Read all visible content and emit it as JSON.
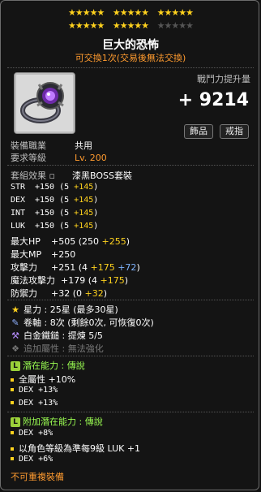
{
  "stars": {
    "row1_filled": 15,
    "row2_filled": 10,
    "row2_empty": 5
  },
  "item": {
    "name": "巨大的恐怖",
    "trade_note": "可交換1次(交易後無法交換)",
    "power_label": "戰鬥力提升量",
    "power_value": "+ 9214",
    "buttons": {
      "accessory": "飾品",
      "ring": "戒指"
    },
    "job_label": "裝備職業",
    "job_value": "共用",
    "level_label": "要求等級",
    "level_value": "Lv. 200",
    "set_label": "套組效果",
    "set_value": "漆黑BOSS套裝",
    "stats": [
      {
        "name": "STR",
        "text": "+150 (5 ",
        "bonus": "+145",
        "close": ")"
      },
      {
        "name": "DEX",
        "text": "+150 (5 ",
        "bonus": "+145",
        "close": ")"
      },
      {
        "name": "INT",
        "text": "+150 (5 ",
        "bonus": "+145",
        "close": ")"
      },
      {
        "name": "LUK",
        "text": "+150 (5 ",
        "bonus": "+145",
        "close": ")"
      }
    ],
    "maxhp": {
      "name": "最大HP",
      "text": "+505 (250 ",
      "bonus": "+255",
      "close": ")"
    },
    "maxmp": {
      "name": "最大MP",
      "text": "+250"
    },
    "atk": {
      "name": "攻擊力",
      "text": "+251 (4 ",
      "bonus": "+175",
      "bonus2": "+72",
      "close": ")"
    },
    "matk": {
      "name": "魔法攻擊力",
      "text": "+179 (4 ",
      "bonus": "+175",
      "close": ")"
    },
    "def": {
      "name": "防禦力",
      "text": "+32 (0 ",
      "bonus": "+32",
      "close": ")"
    },
    "starforce": "星力 : 25星 (最多30星)",
    "scroll": "卷軸 : 8次 (剩餘0次, 可恢復0次)",
    "hammer": "白金鐵鎚 : 提煉 5/5",
    "extra": "追加屬性 : 無法強化",
    "potential_header": "潛在能力 : 傳說",
    "potential": [
      "全屬性 +10%",
      "DEX +13%",
      "DEX +13%"
    ],
    "bonus_header": "附加潛在能力 : 傳說",
    "bonus_potential": [
      "DEX +8%",
      "以角色等級為準每9級 LUK +1",
      "DEX +6%"
    ],
    "footer": "不可重複裝備"
  },
  "colors": {
    "star_on": "#ffd21e",
    "bonus_yellow": "#ffd21e",
    "bonus_blue": "#7fb4ff",
    "legend_green": "#9bff52",
    "orange_note": "#ff9b2f"
  }
}
